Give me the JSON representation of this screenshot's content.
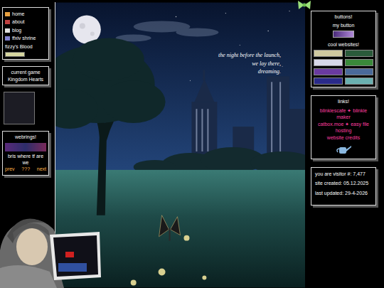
{
  "nav": [
    {
      "label": "home",
      "color": "#e8a040"
    },
    {
      "label": "about",
      "color": "#c04040"
    },
    {
      "label": "blog",
      "color": "#e0e0e0"
    },
    {
      "label": "ffxiv shrine",
      "color": "#8080d0"
    }
  ],
  "nav_extra": "fizzy's Blood",
  "current_game": {
    "label": "current game",
    "value": "Kingdom Hearts"
  },
  "webrings": {
    "title": "webrings!",
    "caption": "bris where tf are we",
    "links": [
      "prev",
      "???",
      "next"
    ]
  },
  "hero": {
    "lines": [
      "the night before the launch,",
      "we lay there,",
      "dreaming."
    ]
  },
  "buttons_box": {
    "title": "buttons!",
    "my_button": "my button",
    "cool": "cool websites!"
  },
  "links": {
    "title": "links!",
    "rows": [
      {
        "site": "blinkiescafe",
        "sep": "✦",
        "desc": "blinkie maker"
      },
      {
        "site": "catbox.moe",
        "sep": "✦",
        "desc": "easy file hosting"
      }
    ],
    "credits": "website credits"
  },
  "counter": [
    "you are visitor #: 7,477",
    "site created: 05.12.2025",
    "last updated: 29-4-2026"
  ]
}
